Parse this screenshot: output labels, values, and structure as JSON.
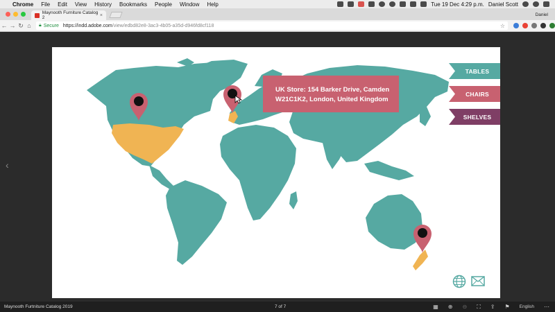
{
  "menubar": {
    "app": "Chrome",
    "items": [
      "File",
      "Edit",
      "View",
      "History",
      "Bookmarks",
      "People",
      "Window",
      "Help"
    ],
    "clock": "Tue 19 Dec  4:29 p.m.",
    "user": "Daniel Scott"
  },
  "tab": {
    "title": "Maynooth Furniture Catalog 2",
    "close": "×"
  },
  "profile_name": "Daniel",
  "address": {
    "secure_label": "Secure",
    "host": "https://indd.adobe.com",
    "path": "/view/edbd82e8-3ac3-4b05-a35d-d946fd8cf118"
  },
  "page": {
    "ribbons": {
      "tables": "TABLES",
      "chairs": "CHAIRS",
      "shelves": "SHELVES"
    },
    "tooltip": {
      "line1": "UK Store: 154 Barker Drive, Camden",
      "line2": "W21C1K2, London, United Kingdom"
    },
    "colors": {
      "land": "#56a9a2",
      "highlight": "#f0b453",
      "pin": "#c86170",
      "shelves": "#7f3e65"
    }
  },
  "bottombar": {
    "title": "Maynooth Furtniture Catalog 2019",
    "pages": "7 of 7",
    "language": "English"
  }
}
